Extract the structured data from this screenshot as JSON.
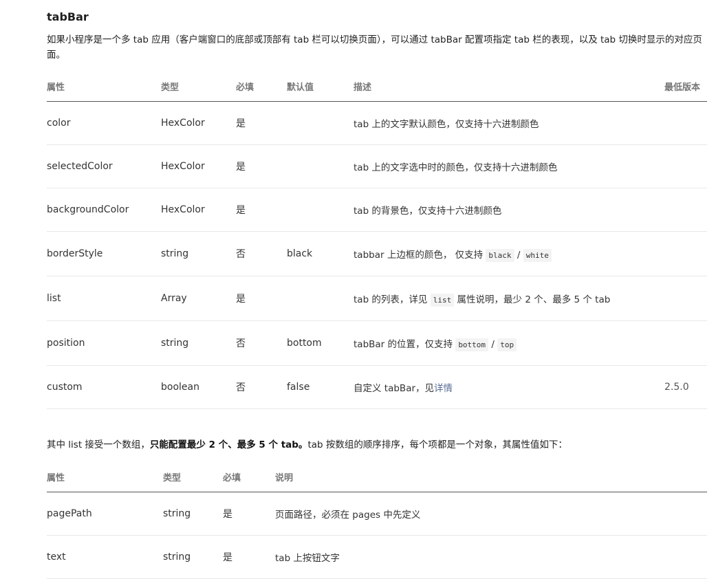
{
  "section": {
    "title": "tabBar",
    "intro": "如果小程序是一个多 tab 应用（客户端窗口的底部或顶部有 tab 栏可以切换页面），可以通过 tabBar 配置项指定 tab 栏的表现，以及 tab 切换时显示的对应页面。"
  },
  "table1": {
    "headers": [
      "属性",
      "类型",
      "必填",
      "默认值",
      "描述",
      "最低版本"
    ],
    "rows": [
      {
        "attr": "color",
        "type": "HexColor",
        "required": "是",
        "default": "",
        "desc": "tab 上的文字默认颜色，仅支持十六进制颜色",
        "version": ""
      },
      {
        "attr": "selectedColor",
        "type": "HexColor",
        "required": "是",
        "default": "",
        "desc": "tab 上的文字选中时的颜色，仅支持十六进制颜色",
        "version": ""
      },
      {
        "attr": "backgroundColor",
        "type": "HexColor",
        "required": "是",
        "default": "",
        "desc": "tab 的背景色，仅支持十六进制颜色",
        "version": ""
      },
      {
        "attr": "borderStyle",
        "type": "string",
        "required": "否",
        "default": "black",
        "desc_prefix": "tabbar 上边框的颜色， 仅支持",
        "code_a": "black",
        "sep": "/",
        "code_b": "white",
        "version": ""
      },
      {
        "attr": "list",
        "type": "Array",
        "required": "是",
        "default": "",
        "desc_prefix": "tab 的列表，详见",
        "code_a": "list",
        "desc_suffix": "属性说明，最少 2 个、最多 5 个 tab",
        "version": ""
      },
      {
        "attr": "position",
        "type": "string",
        "required": "否",
        "default": "bottom",
        "desc_prefix": "tabBar 的位置，仅支持",
        "code_a": "bottom",
        "sep": "/",
        "code_b": "top",
        "version": ""
      },
      {
        "attr": "custom",
        "type": "boolean",
        "required": "否",
        "default": "false",
        "desc_prefix": "自定义 tabBar，见",
        "link": "详情",
        "version": "2.5.0"
      }
    ]
  },
  "list_note": {
    "prefix": "其中 list 接受一个数组，",
    "bold": "只能配置最少 2 个、最多 5 个 tab。",
    "suffix": "tab 按数组的顺序排序，每个项都是一个对象，其属性值如下："
  },
  "table2": {
    "headers": [
      "属性",
      "类型",
      "必填",
      "说明"
    ],
    "rows": [
      {
        "attr": "pagePath",
        "type": "string",
        "required": "是",
        "desc": "页面路径，必须在 pages 中先定义"
      },
      {
        "attr": "text",
        "type": "string",
        "required": "是",
        "desc": "tab 上按钮文字"
      }
    ]
  }
}
